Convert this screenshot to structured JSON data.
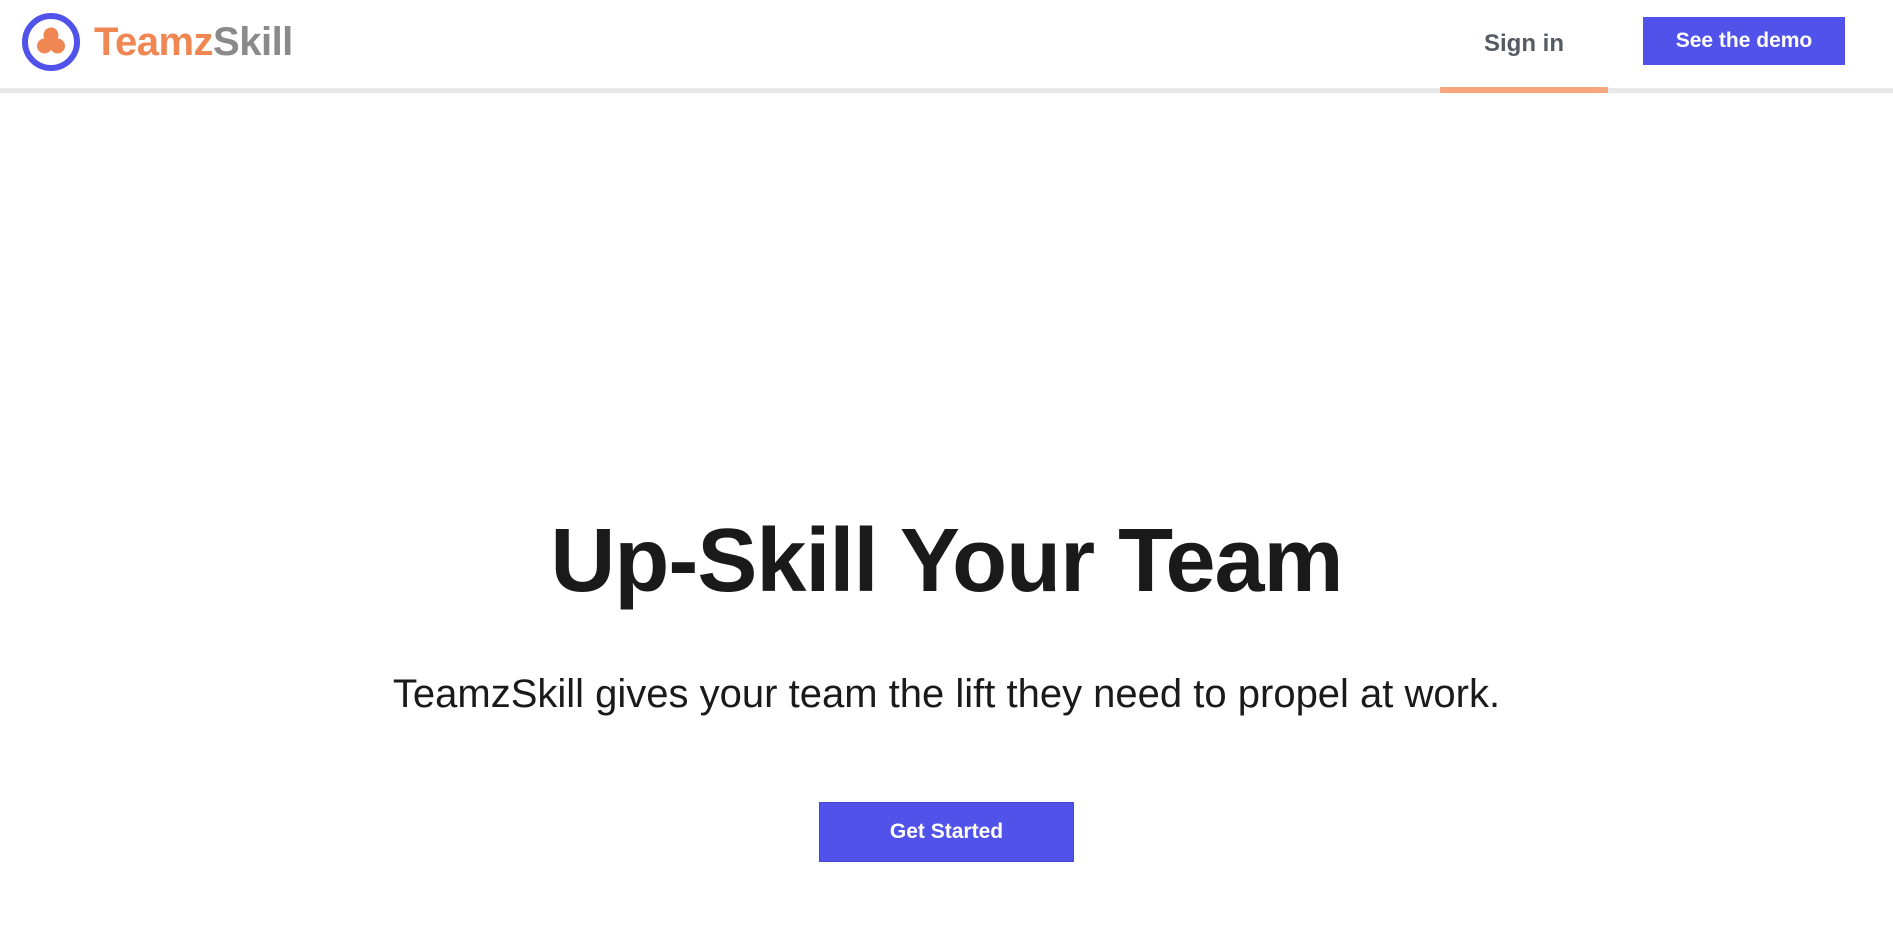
{
  "brand": {
    "name_part1": "Teamz",
    "name_part2": "Skill",
    "icon": "logo-circle-icon",
    "colors": {
      "primary": "#5152ea",
      "accent": "#f08752",
      "gray": "#8a8a8a"
    }
  },
  "nav": {
    "signin_label": "Sign in",
    "demo_label": "See the demo",
    "active_item": "Sign in"
  },
  "hero": {
    "title": "Up-Skill Your Team",
    "subtitle": "TeamzSkill gives your team the lift they need to propel at work.",
    "cta_label": "Get Started"
  }
}
